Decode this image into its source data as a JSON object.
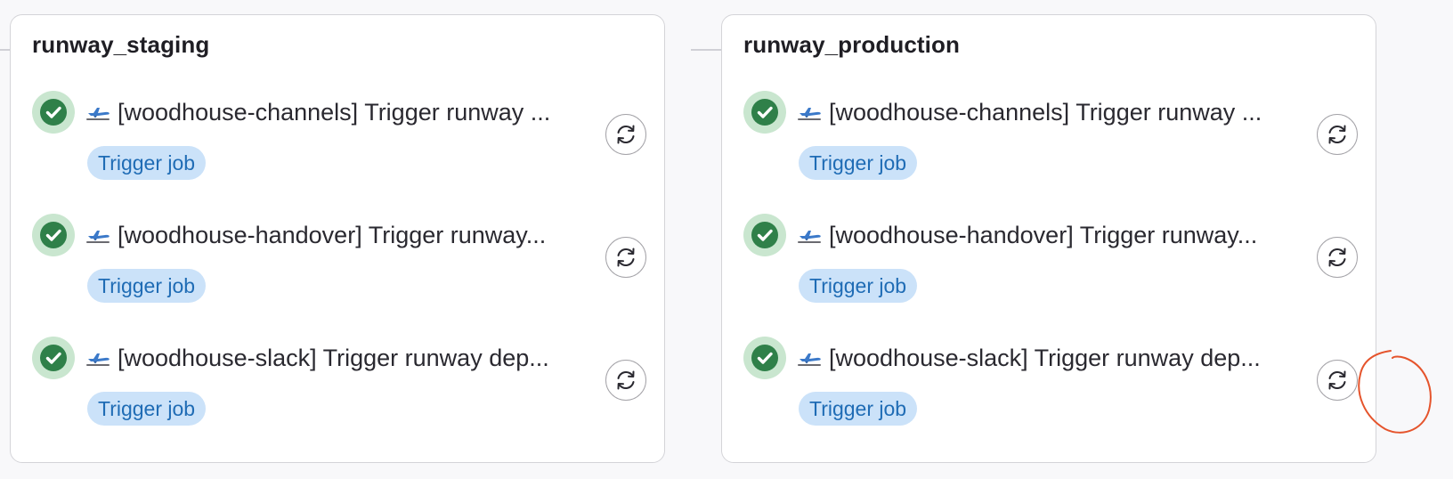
{
  "annotation_color": "#e5542c",
  "accent": {
    "success": "#2f8049",
    "success_bg": "#c9e6cf",
    "badge_bg": "#cbe2f9",
    "badge_text": "#1f6cb5"
  },
  "stages": [
    {
      "name": "runway_staging",
      "jobs": [
        {
          "icon": "airplane-departure-icon",
          "title": "[woodhouse-channels] Trigger runway ...",
          "badge": "Trigger job",
          "status": "success"
        },
        {
          "icon": "airplane-departure-icon",
          "title": "[woodhouse-handover] Trigger runway...",
          "badge": "Trigger job",
          "status": "success"
        },
        {
          "icon": "airplane-departure-icon",
          "title": "[woodhouse-slack] Trigger runway dep...",
          "badge": "Trigger job",
          "status": "success"
        }
      ]
    },
    {
      "name": "runway_production",
      "jobs": [
        {
          "icon": "airplane-departure-icon",
          "title": "[woodhouse-channels] Trigger runway ...",
          "badge": "Trigger job",
          "status": "success"
        },
        {
          "icon": "airplane-departure-icon",
          "title": "[woodhouse-handover] Trigger runway...",
          "badge": "Trigger job",
          "status": "success"
        },
        {
          "icon": "airplane-departure-icon",
          "title": "[woodhouse-slack] Trigger runway dep...",
          "badge": "Trigger job",
          "status": "success"
        }
      ]
    }
  ]
}
